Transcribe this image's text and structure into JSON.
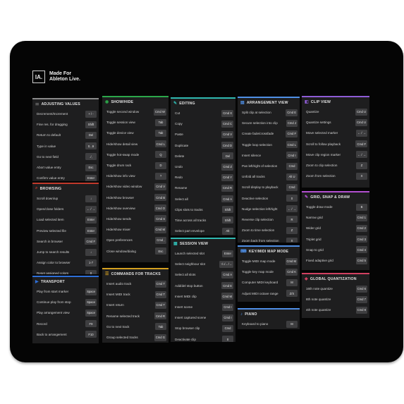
{
  "brand": {
    "mark": "IA.",
    "line1": "Made For",
    "line2": "Ableton Live."
  },
  "colors": {
    "mat": "#050505",
    "panel": "#1e1e1f",
    "key": "#3e3e40"
  },
  "adjusting_values": {
    "title": "Adjusting Values",
    "accent": "#8a8a8a",
    "icon": "sliders-icon",
    "items": [
      {
        "label": "Decrement/Increment",
        "key": "+ / -"
      },
      {
        "label": "Fine res. for dragging",
        "key": "Shift"
      },
      {
        "label": "Return to default",
        "key": "Del"
      },
      {
        "label": "Type in value",
        "key": "0...9"
      },
      {
        "label": "Go to next field",
        "key": "./,"
      },
      {
        "label": "Abort value entry",
        "key": "Esc"
      },
      {
        "label": "Confirm value entry",
        "key": "Enter"
      }
    ]
  },
  "browsing": {
    "title": "Browsing",
    "accent": "#c0392b",
    "icon": "search-icon",
    "items": [
      {
        "label": "Scroll down/up",
        "key": "↓"
      },
      {
        "label": "Open/close folders",
        "key": "← / →"
      },
      {
        "label": "Load selected item",
        "key": "Enter"
      },
      {
        "label": "Preview selected file",
        "key": "Enter"
      },
      {
        "label": "Search in browser",
        "key": "Cmd F"
      },
      {
        "label": "Jump to search results",
        "key": "↓"
      },
      {
        "label": "Assign color to browser",
        "key": "1-7"
      },
      {
        "label": "Reset assigned colors",
        "key": "0"
      }
    ]
  },
  "transport": {
    "title": "Transport",
    "accent": "#2e6fd8",
    "icon": "transport-icon",
    "items": [
      {
        "label": "Play from start marker",
        "key": "Space"
      },
      {
        "label": "Continue play from stop",
        "key": "Space"
      },
      {
        "label": "Play arrangement view",
        "key": "Space"
      },
      {
        "label": "Record",
        "key": "F9"
      },
      {
        "label": "Back to arrangement",
        "key": "F10"
      }
    ]
  },
  "show_hide": {
    "title": "Show/Hide",
    "accent": "#2ca84a",
    "icon": "eye-icon",
    "items": [
      {
        "label": "Toggle second window",
        "key": "Cmd W"
      },
      {
        "label": "Toggle session view",
        "key": "Tab"
      },
      {
        "label": "Toggle device view",
        "key": "Tab"
      },
      {
        "label": "Hide/show detail view",
        "key": "Cmd L"
      },
      {
        "label": "Toggle hot-swap mode",
        "key": "Q"
      },
      {
        "label": "Toggle drum rack",
        "key": "D"
      },
      {
        "label": "Hide/show info view",
        "key": "?"
      },
      {
        "label": "Hide/show video window",
        "key": "Cmd V"
      },
      {
        "label": "Hide/show browser",
        "key": "Cmd B"
      },
      {
        "label": "Hide/show overview",
        "key": "Cmd O"
      },
      {
        "label": "Hide/show sends",
        "key": "Cmd S"
      },
      {
        "label": "Hide/show mixer",
        "key": "Cmd M"
      },
      {
        "label": "Open preferences",
        "key": "Cmd ,"
      },
      {
        "label": "Close window/dialog",
        "key": "Esc"
      }
    ]
  },
  "commands_for_tracks": {
    "title": "Commands for Tracks",
    "accent": "#d4a020",
    "icon": "tracks-icon",
    "items": [
      {
        "label": "Insert audio track",
        "key": "Cmd T"
      },
      {
        "label": "Insert MIDI track",
        "key": "Cmd T"
      },
      {
        "label": "Insert return",
        "key": "Cmd T"
      },
      {
        "label": "Rename selected track",
        "key": "Cmd R"
      },
      {
        "label": "Go to next track",
        "key": "Tab"
      },
      {
        "label": "Group selected tracks",
        "key": "Cmd G"
      }
    ]
  },
  "editing": {
    "title": "Editing",
    "accent": "#2fb8b0",
    "icon": "pencil-icon",
    "items": [
      {
        "label": "Cut",
        "key": "Cmd X"
      },
      {
        "label": "Copy",
        "key": "Cmd C"
      },
      {
        "label": "Paste",
        "key": "Cmd V"
      },
      {
        "label": "Duplicate",
        "key": "Cmd D"
      },
      {
        "label": "Delete",
        "key": "Del"
      },
      {
        "label": "Undo",
        "key": "Cmd Z"
      },
      {
        "label": "Redo",
        "key": "Cmd Y"
      },
      {
        "label": "Rename",
        "key": "Cmd R"
      },
      {
        "label": "Select all",
        "key": "Cmd A"
      },
      {
        "label": "Clips slots to tracks",
        "key": "Shift"
      },
      {
        "label": "Time across all tracks",
        "key": "Shift"
      },
      {
        "label": "Select part envelope",
        "key": "Alt"
      }
    ]
  },
  "session_view": {
    "title": "Session View",
    "accent": "#2fb8b0",
    "icon": "grid-icon",
    "items": [
      {
        "label": "Launch selected slot",
        "key": "Enter"
      },
      {
        "label": "Select neighbour slot",
        "key": "↑/↓/←/→"
      },
      {
        "label": "Select all slots",
        "key": "Cmd A"
      },
      {
        "label": "Add/del stop button",
        "key": "Cmd E"
      },
      {
        "label": "Insert MIDI clip",
        "key": "Cmd M"
      },
      {
        "label": "Insert scene",
        "key": "Cmd I"
      },
      {
        "label": "Insert captured scene",
        "key": "Cmd I"
      },
      {
        "label": "Stop browser clip",
        "key": "Cmd"
      },
      {
        "label": "Deactivate clip",
        "key": "0"
      }
    ]
  },
  "arrangement_view": {
    "title": "Arrangement View",
    "accent": "#4f8fe6",
    "icon": "arrangement-icon",
    "items": [
      {
        "label": "Split clip at selection",
        "key": "Cmd E"
      },
      {
        "label": "Secure selection into clip",
        "key": "Cmd J"
      },
      {
        "label": "Create fade/crossfade",
        "key": "Cmd F"
      },
      {
        "label": "Toggle loop selection",
        "key": "Cmd L"
      },
      {
        "label": "Insert silence",
        "key": "Cmd I"
      },
      {
        "label": "Pan left/right of selection",
        "key": "Cmd"
      },
      {
        "label": "Unfold all tracks",
        "key": "Alt U"
      },
      {
        "label": "Scroll display to playback",
        "key": "Cmd"
      },
      {
        "label": "Deactive selection",
        "key": "0"
      },
      {
        "label": "Nudge selection left/right",
        "key": "← / →"
      },
      {
        "label": "Reverse clip selection",
        "key": "R"
      },
      {
        "label": "Zoom to time selection",
        "key": "Z"
      },
      {
        "label": "Zoom back from selection",
        "key": "X"
      }
    ]
  },
  "key_midi_map_mode": {
    "title": "Key/MIDI Map Mode",
    "accent": "#4f8fe6",
    "icon": "keyboard-icon",
    "items": [
      {
        "label": "Toggle MIDI map mode",
        "key": "Cmd M"
      },
      {
        "label": "Toggle key map mode",
        "key": "Cmd K"
      },
      {
        "label": "Computer MIDI keyboard",
        "key": "M"
      },
      {
        "label": "Adjust MIDI octave range",
        "key": "Z/X"
      }
    ]
  },
  "piano": {
    "title": "Piano",
    "accent": "#4f8fe6",
    "icon": "piano-icon",
    "items": [
      {
        "label": "Keyboard to piano",
        "key": "M"
      }
    ]
  },
  "clip_view": {
    "title": "Clip View",
    "accent": "#8e5cd6",
    "icon": "clip-icon",
    "items": [
      {
        "label": "Quantize",
        "key": "Cmd U"
      },
      {
        "label": "Quantize settings",
        "key": "Cmd U"
      },
      {
        "label": "Move selected marker",
        "key": "← / →"
      },
      {
        "label": "Scroll to follow playback",
        "key": "Cmd F"
      },
      {
        "label": "Move clip region marker",
        "key": "← / →"
      },
      {
        "label": "Zoom to clip selection",
        "key": "Z"
      },
      {
        "label": "Zoom from selection",
        "key": "X"
      }
    ]
  },
  "grid_snap_draw": {
    "title": "Grid, Snap & Draw",
    "accent": "#b24fd0",
    "icon": "pencil-icon",
    "items": [
      {
        "label": "Toggle draw mode",
        "key": "B"
      },
      {
        "label": "Narrow grid",
        "key": "Cmd 1"
      },
      {
        "label": "Wider grid",
        "key": "Cmd 2"
      },
      {
        "label": "Triplet grid",
        "key": "Cmd 3"
      },
      {
        "label": "Snap to grid",
        "key": "Cmd 4"
      },
      {
        "label": "Fixed adaptive grid",
        "key": "Cmd 5"
      }
    ]
  },
  "global_quantization": {
    "title": "Global Quantization",
    "accent": "#d04060",
    "icon": "quantize-icon",
    "items": [
      {
        "label": "16th note quantize",
        "key": "Cmd 6"
      },
      {
        "label": "8th note quantize",
        "key": "Cmd 7"
      },
      {
        "label": "4th note quantize",
        "key": "Cmd 8"
      }
    ]
  }
}
